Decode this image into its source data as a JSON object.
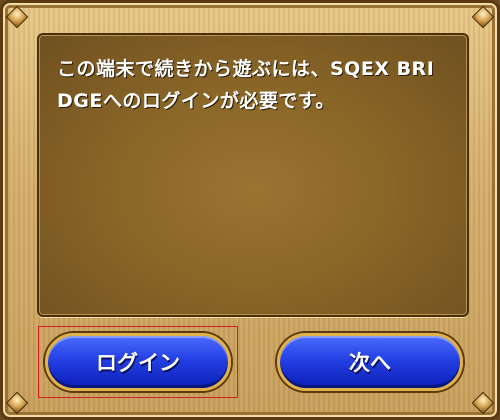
{
  "dialog": {
    "message": "この端末で続きから遊ぶには、SQEX BRIDGEへのログインが必要です。"
  },
  "buttons": {
    "login_label": "ログイン",
    "next_label": "次へ"
  },
  "colors": {
    "frame_wood": "#d4ad6a",
    "panel_brown": "#8a6627",
    "button_blue": "#2440e3",
    "button_border_gold": "#e2b24a",
    "selection_red": "#d21f1f"
  }
}
